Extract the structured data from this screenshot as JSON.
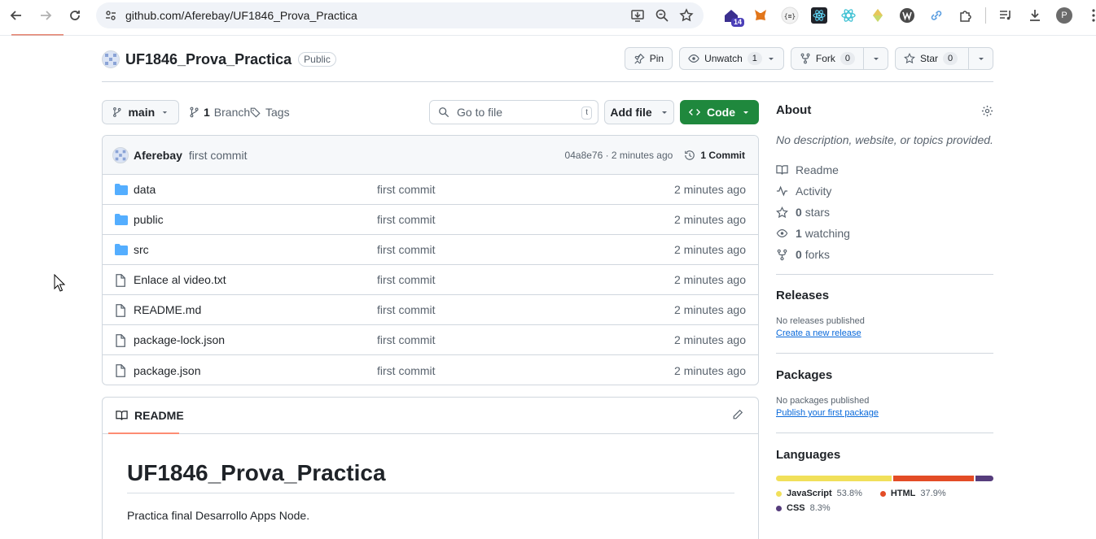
{
  "browser": {
    "url": "github.com/Aferebay/UF1846_Prova_Practica",
    "extension_badge": "14",
    "profile_initial": "P"
  },
  "repo": {
    "name": "UF1846_Prova_Practica",
    "visibility": "Public",
    "pin_label": "Pin",
    "unwatch_label": "Unwatch",
    "watch_count": "1",
    "fork_label": "Fork",
    "fork_count": "0",
    "star_label": "Star",
    "star_count": "0"
  },
  "filenav": {
    "branch": "main",
    "branch_count": "1",
    "branch_label": "Branch",
    "tags_label": "Tags",
    "goto_placeholder": "Go to file",
    "goto_shortcut": "t",
    "add_file_label": "Add file",
    "code_label": "Code"
  },
  "commit": {
    "author": "Aferebay",
    "message": "first commit",
    "hash_time": "04a8e76 · 2 minutes ago",
    "count_label": "1 Commit"
  },
  "files": [
    {
      "name": "data",
      "type": "folder",
      "message": "first commit",
      "date": "2 minutes ago"
    },
    {
      "name": "public",
      "type": "folder",
      "message": "first commit",
      "date": "2 minutes ago"
    },
    {
      "name": "src",
      "type": "folder",
      "message": "first commit",
      "date": "2 minutes ago"
    },
    {
      "name": "Enlace al video.txt",
      "type": "file",
      "message": "first commit",
      "date": "2 minutes ago"
    },
    {
      "name": "README.md",
      "type": "file",
      "message": "first commit",
      "date": "2 minutes ago"
    },
    {
      "name": "package-lock.json",
      "type": "file",
      "message": "first commit",
      "date": "2 minutes ago"
    },
    {
      "name": "package.json",
      "type": "file",
      "message": "first commit",
      "date": "2 minutes ago"
    }
  ],
  "readme": {
    "tab_label": "README",
    "title": "UF1846_Prova_Practica",
    "body": "Practica final Desarrollo Apps Node."
  },
  "about": {
    "title": "About",
    "description": "No description, website, or topics provided.",
    "readme": "Readme",
    "activity": "Activity",
    "stars_count": "0",
    "stars_label": "stars",
    "watching_count": "1",
    "watching_label": "watching",
    "forks_count": "0",
    "forks_label": "forks"
  },
  "releases": {
    "title": "Releases",
    "empty_text": "No releases published",
    "link": "Create a new release"
  },
  "packages": {
    "title": "Packages",
    "empty_text": "No packages published",
    "link": "Publish your first package"
  },
  "languages": {
    "title": "Languages",
    "items": [
      {
        "name": "JavaScript",
        "pct": "53.8%",
        "value": 53.8,
        "color": "#f1e05a"
      },
      {
        "name": "HTML",
        "pct": "37.9%",
        "value": 37.9,
        "color": "#e34c26"
      },
      {
        "name": "CSS",
        "pct": "8.3%",
        "value": 8.3,
        "color": "#563d7c"
      }
    ]
  },
  "colors": {
    "accent_green": "#1f883d",
    "link_blue": "#0969da",
    "folder_blue": "#54aeff"
  }
}
